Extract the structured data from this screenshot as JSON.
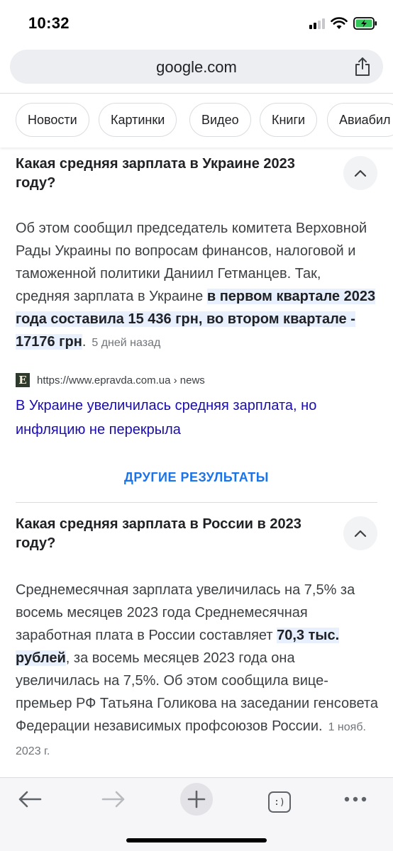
{
  "status_bar": {
    "time": "10:32",
    "battery_color": "#34c759"
  },
  "address_bar": {
    "url": "google.com"
  },
  "chips": [
    "Новости",
    "Картинки",
    "Видео",
    "Книги",
    "Авиабил"
  ],
  "qa1": {
    "question": "Какая средняя зарплата в Украине 2023 году?",
    "answer_plain": "Об этом сообщил председатель комитета Верховной Рады Украины по вопросам финансов, налоговой и таможенной политики Даниил Гетманцев. Так, средняя зарплата в Украине ",
    "answer_highlight": "в первом квартале 2023 года составила 15 436 грн, во втором квартале - 17176 грн",
    "answer_end": ".",
    "date": "5 дней назад",
    "source_url": "https://www.epravda.com.ua › news",
    "favicon_letter": "E",
    "link_title": "В Украине увеличилась средняя зарплата, но инфляцию не перекрыла"
  },
  "more_results": "ДРУГИЕ РЕЗУЛЬТАТЫ",
  "qa2": {
    "question": "Какая средняя зарплата в России в 2023 году?",
    "answer_plain": "Среднемесячная зарплата увеличилась на 7,5% за восемь месяцев 2023 года Среднемесячная заработная плата в России составляет ",
    "answer_highlight": "70,3 тыс. рублей",
    "answer_end": ", за восемь месяцев 2023 года она увеличилась на 7,5%. Об этом сообщила вице-премьер РФ Татьяна Голикова на заседании генсовета Федерации независимых профсоюзов России.",
    "date": "1 нояб. 2023 г."
  },
  "toolbar": {
    "tabs_label": ":)"
  },
  "colors": {
    "link": "#1a0dab",
    "accent": "#1a73e8",
    "highlight": "#e8f0fe"
  }
}
